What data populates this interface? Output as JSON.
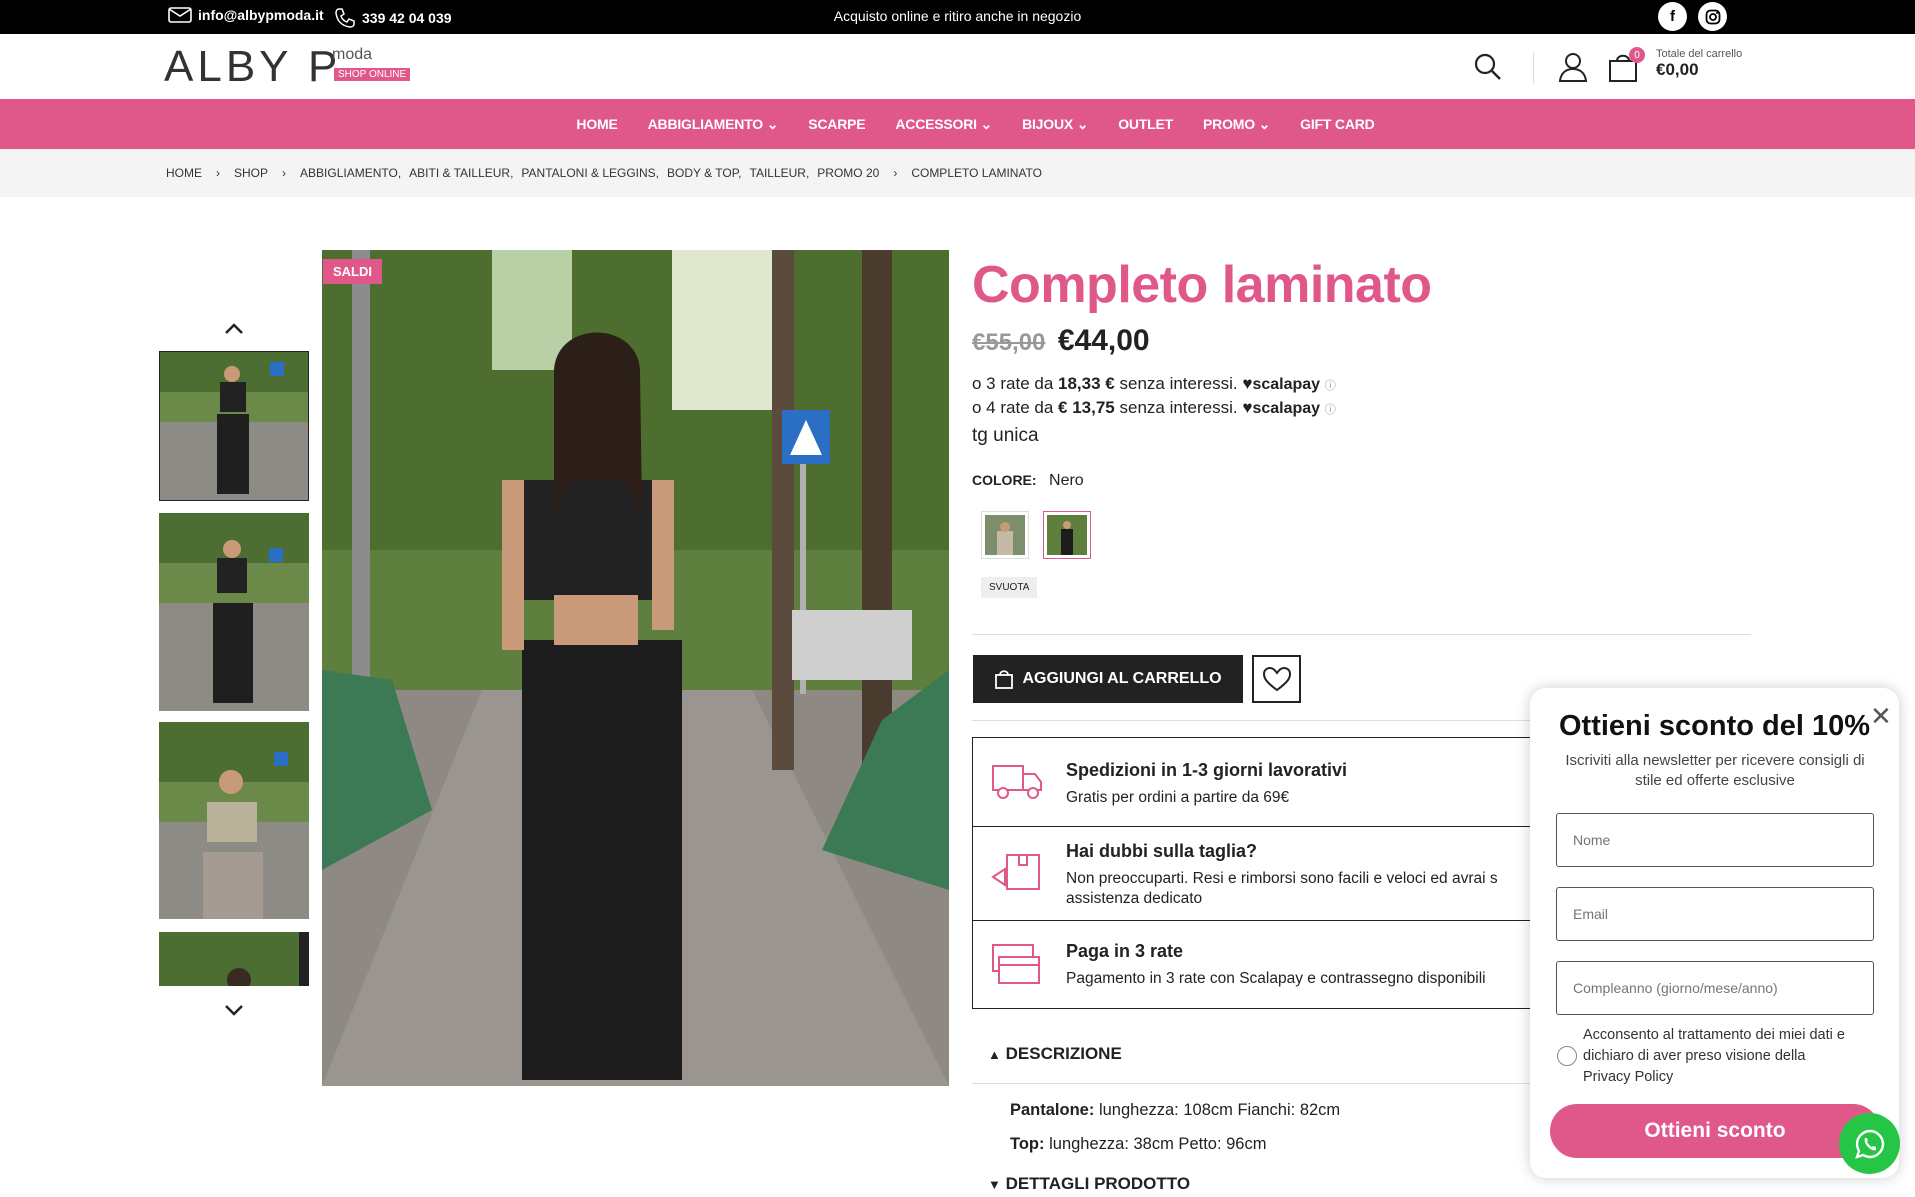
{
  "topbar": {
    "email": "info@albypmoda.it",
    "phone": "339 42 04 039",
    "promo": "Acquisto online e ritiro anche in negozio",
    "social": [
      "facebook-icon",
      "instagram-icon"
    ]
  },
  "logo": {
    "name": "ALBY P.",
    "moda": "moda",
    "shop": "SHOP ONLINE"
  },
  "cart": {
    "label": "Totale del carrello",
    "total": "€0,00",
    "count": "0"
  },
  "nav": [
    "HOME",
    "ABBIGLIAMENTO",
    "SCARPE",
    "ACCESSORI",
    "BIJOUX",
    "OUTLET",
    "PROMO",
    "GIFT CARD"
  ],
  "nav_dropdowns": [
    false,
    true,
    false,
    true,
    true,
    false,
    true,
    false
  ],
  "breadcrumb": [
    "HOME",
    "SHOP",
    "ABBIGLIAMENTO,",
    "ABITI & TAILLEUR,",
    "PANTALONI & LEGGINS,",
    "BODY & TOP,",
    "TAILLEUR,",
    "PROMO 20",
    "COMPLETO LAMINATO"
  ],
  "product": {
    "badge": "SALDI",
    "title": "Completo laminato",
    "old_price": "€55,00",
    "price": "€44,00",
    "rate3_a": "o 3 rate da",
    "rate3_v": "18,33 €",
    "rate_b": "senza interessi.",
    "rate4_a": "o 4 rate da",
    "rate4_v": "€ 13,75",
    "scalapay": "scalapay",
    "size": "tg unica",
    "color_label": "COLORE:",
    "color_value": "Nero",
    "clear": "SVUOTA",
    "add_to_cart": "AGGIUNGI AL CARRELLO"
  },
  "info": [
    {
      "title": "Spedizioni in 1-3 giorni lavorativi",
      "desc": "Gratis per ordini a partire da 69€"
    },
    {
      "title": "Hai dubbi sulla taglia?",
      "desc": "Non preoccuparti. Resi e rimborsi sono facili e veloci ed avrai s",
      "desc2": "assistenza dedicato"
    },
    {
      "title": "Paga in 3 rate",
      "desc": "Pagamento in 3 rate con Scalapay e contrassegno disponibili"
    }
  ],
  "description": {
    "heading": "DESCRIZIONE",
    "pant_label": "Pantalone:",
    "pant": "lunghezza: 108cm Fianchi: 82cm",
    "top_label": "Top:",
    "top": "lunghezza: 38cm Petto: 96cm",
    "details": "DETTAGLI PRODOTTO"
  },
  "popup": {
    "title": "Ottieni sconto del 10%",
    "subtitle": "Iscriviti alla newsletter per ricevere consigli di stile ed offerte esclusive",
    "name_ph": "Nome",
    "email_ph": "Email",
    "birthday_ph": "Compleanno (giorno/mese/anno)",
    "consent": "Acconsento al trattamento dei miei dati e dichiaro di aver preso visione della Privacy Policy",
    "cta": "Ottieni sconto"
  },
  "colors": {
    "brand": "#e0578a",
    "dark": "#222222",
    "whatsapp": "#25c545"
  }
}
